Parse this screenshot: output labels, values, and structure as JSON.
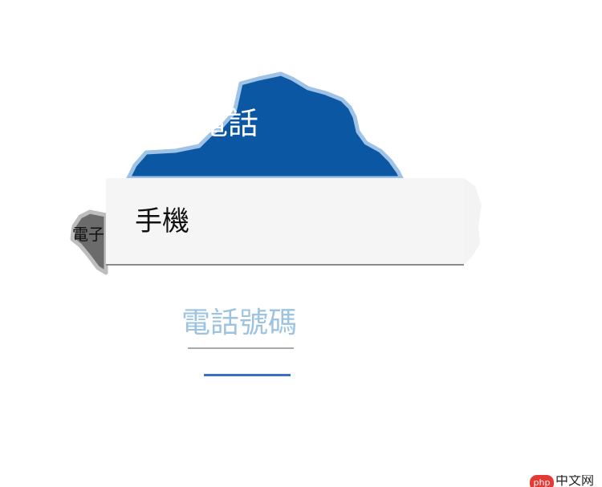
{
  "header": {
    "title": "電話"
  },
  "side": {
    "label": "電子"
  },
  "dropdown": {
    "items": [
      {
        "label": "手機"
      }
    ]
  },
  "form": {
    "phone": {
      "placeholder": "電話號碼",
      "value": ""
    }
  },
  "watermark": {
    "badge": "php",
    "text": "中文网"
  },
  "colors": {
    "header_blue": "#0b57a4",
    "menu_bg": "#f5f5f5",
    "placeholder_blue": "#9cc3e0",
    "accent_blue": "#3d6fc4",
    "watermark_red": "#e53935"
  }
}
